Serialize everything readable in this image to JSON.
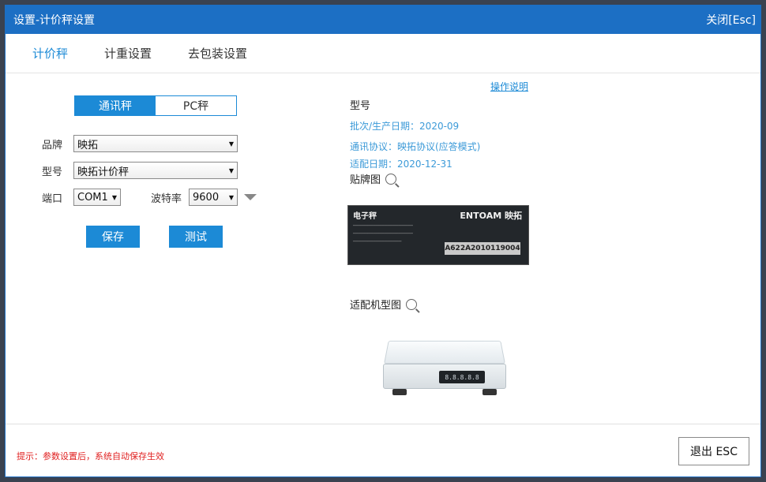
{
  "window": {
    "title": "设置-计价秤设置",
    "close_label": "关闭[Esc]"
  },
  "tabs": [
    {
      "label": "计价秤",
      "active": true
    },
    {
      "label": "计重设置",
      "active": false
    },
    {
      "label": "去包装设置",
      "active": false
    }
  ],
  "mode": {
    "options": [
      "通讯秤",
      "PC秤"
    ],
    "selected": "通讯秤"
  },
  "form": {
    "brand_label": "品牌",
    "brand_value": "映拓",
    "model_label": "型号",
    "model_value": "映拓计价秤",
    "port_label": "端口",
    "port_value": "COM1",
    "baud_label": "波特率",
    "baud_value": "9600"
  },
  "buttons": {
    "save": "保存",
    "test": "测试"
  },
  "info": {
    "help_link": "操作说明",
    "model_title": "型号",
    "batch": "批次/生产日期：2020-09",
    "protocol": "通讯协议：映拓协议(应答模式)",
    "adapt_date": "适配日期：2020-12-31",
    "nameplate_title": "贴牌图",
    "adapted_title": "适配机型图"
  },
  "nameplate": {
    "left_title": "电子秤",
    "right_title": "ENTOAM 映拓",
    "serial": "A622A2010119004"
  },
  "scale_display": "8.8.8.8.8",
  "footer": {
    "tip": "提示：参数设置后，系统自动保存生效",
    "exit_label": "退出 ESC"
  },
  "colors": {
    "accent": "#1c8ad6",
    "titlebar": "#1c6fc4",
    "tip": "#e02020"
  }
}
